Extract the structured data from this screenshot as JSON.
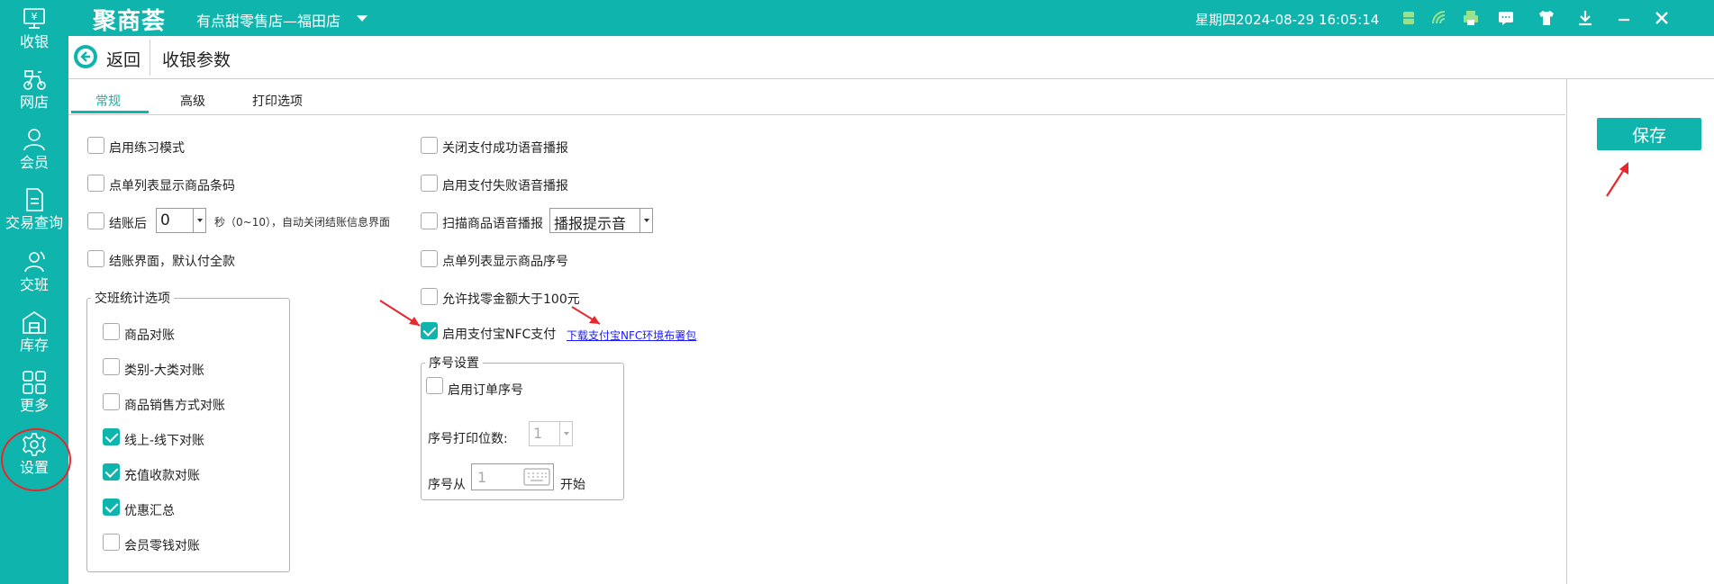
{
  "sidebar": {
    "items": [
      {
        "label": "收银",
        "icon": "cashier-icon"
      },
      {
        "label": "网店",
        "icon": "scooter-icon"
      },
      {
        "label": "会员",
        "icon": "member-icon"
      },
      {
        "label": "交易查询",
        "icon": "document-icon"
      },
      {
        "label": "交班",
        "icon": "shift-icon"
      },
      {
        "label": "库存",
        "icon": "warehouse-icon"
      },
      {
        "label": "更多",
        "icon": "grid-icon"
      },
      {
        "label": "设置",
        "icon": "gear-icon"
      }
    ]
  },
  "topbar": {
    "logo": "聚商荟",
    "store": "有点甜零售店—福田店",
    "datetime": "星期四2024-08-29 16:05:14"
  },
  "header": {
    "back_label": "返回",
    "page_title": "收银参数"
  },
  "tabs": [
    {
      "label": "常规",
      "active": true
    },
    {
      "label": "高级",
      "active": false
    },
    {
      "label": "打印选项",
      "active": false
    }
  ],
  "save_label": "保存",
  "left_options": {
    "practice_mode": {
      "label": "启用练习模式",
      "checked": false
    },
    "show_barcode": {
      "label": "点单列表显示商品条码",
      "checked": false
    },
    "after_checkout": {
      "label": "结账后",
      "checked": false,
      "value": "0",
      "suffix": "秒（0~10），自动关闭结账信息界面"
    },
    "default_full_pay": {
      "label": "结账界面，默认付全款",
      "checked": false
    }
  },
  "shift_group": {
    "title": "交班统计选项",
    "items": [
      {
        "label": "商品对账",
        "checked": false
      },
      {
        "label": "类别-大类对账",
        "checked": false
      },
      {
        "label": "商品销售方式对账",
        "checked": false
      },
      {
        "label": "线上-线下对账",
        "checked": true
      },
      {
        "label": "充值收款对账",
        "checked": true
      },
      {
        "label": "优惠汇总",
        "checked": true
      },
      {
        "label": "会员零钱对账",
        "checked": false
      }
    ]
  },
  "right_options": {
    "disable_success_voice": {
      "label": "关闭支付成功语音播报",
      "checked": false
    },
    "enable_fail_voice": {
      "label": "启用支付失败语音播报",
      "checked": false
    },
    "scan_voice": {
      "label": "扫描商品语音播报",
      "checked": false,
      "select_value": "播报提示音"
    },
    "show_seq": {
      "label": "点单列表显示商品序号",
      "checked": false
    },
    "allow_change": {
      "label": "允许找零金额大于100元",
      "checked": false
    },
    "alipay_nfc": {
      "label": "启用支付宝NFC支付",
      "checked": true,
      "link": "下载支付宝NFC环境布署包"
    }
  },
  "seq_group": {
    "title": "序号设置",
    "enable_order_seq": {
      "label": "启用订单序号",
      "checked": false
    },
    "print_digits_label": "序号打印位数:",
    "print_digits_value": "1",
    "start_from_label": "序号从",
    "start_from_value": "1",
    "start_suffix": "开始"
  },
  "colors": {
    "accent": "#0fb5ad",
    "annotation": "#e8262d",
    "link": "#1a1aff"
  }
}
